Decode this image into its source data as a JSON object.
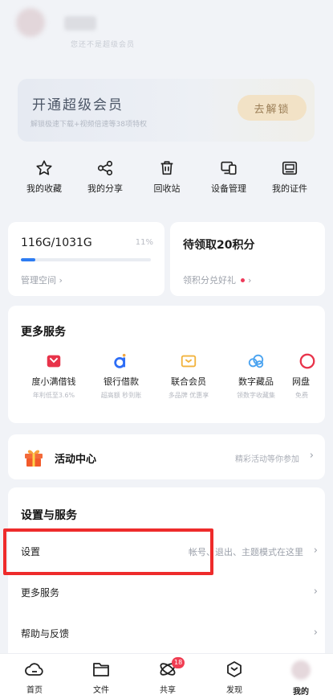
{
  "account": {
    "vip_status": "您还不是超级会员"
  },
  "vip_card": {
    "title": "开通超级会员",
    "desc": "解锁极速下载+视频倍速等38项特权",
    "button": "去解锁"
  },
  "quick_actions": [
    {
      "label": "我的收藏",
      "icon": "star-icon"
    },
    {
      "label": "我的分享",
      "icon": "share-icon"
    },
    {
      "label": "回收站",
      "icon": "trash-icon"
    },
    {
      "label": "设备管理",
      "icon": "devices-icon"
    },
    {
      "label": "我的证件",
      "icon": "id-card-icon"
    }
  ],
  "storage": {
    "usage": "116G/1031G",
    "percent": "11%",
    "fill_fraction": 0.11,
    "manage": "管理空间"
  },
  "points": {
    "title": "待领取20积分",
    "link": "领积分兑好礼"
  },
  "more_services": {
    "title": "更多服务",
    "items": [
      {
        "name": "度小满借钱",
        "sub": "年利低至3.6%",
        "color": "#e8334a"
      },
      {
        "name": "银行借款",
        "sub": "超高额 秒到账",
        "color": "#2d6df6"
      },
      {
        "name": "联合会员",
        "sub": "多品牌 优惠享",
        "color": "#f2b33d"
      },
      {
        "name": "数字藏品",
        "sub": "领数字收藏集",
        "color": "#4aa3f0"
      },
      {
        "name": "网盘",
        "sub": "免费",
        "color": "#e8334a"
      }
    ]
  },
  "activity": {
    "title": "活动中心",
    "sub": "精彩活动等你参加"
  },
  "settings": {
    "title": "设置与服务",
    "rows": [
      {
        "label": "设置",
        "desc": "帐号、退出、主题模式在这里"
      },
      {
        "label": "更多服务",
        "desc": ""
      },
      {
        "label": "帮助与反馈",
        "desc": ""
      }
    ]
  },
  "tabbar": {
    "items": [
      {
        "label": "首页",
        "icon": "home-cloud-icon"
      },
      {
        "label": "文件",
        "icon": "folder-icon"
      },
      {
        "label": "共享",
        "icon": "share-orbit-icon",
        "badge": "18"
      },
      {
        "label": "发现",
        "icon": "discover-icon"
      },
      {
        "label": "我的",
        "icon": "avatar"
      }
    ]
  },
  "colors": {
    "accent": "#2d7cf2",
    "highlight": "#ee2b2b",
    "badge": "#f03d52"
  }
}
